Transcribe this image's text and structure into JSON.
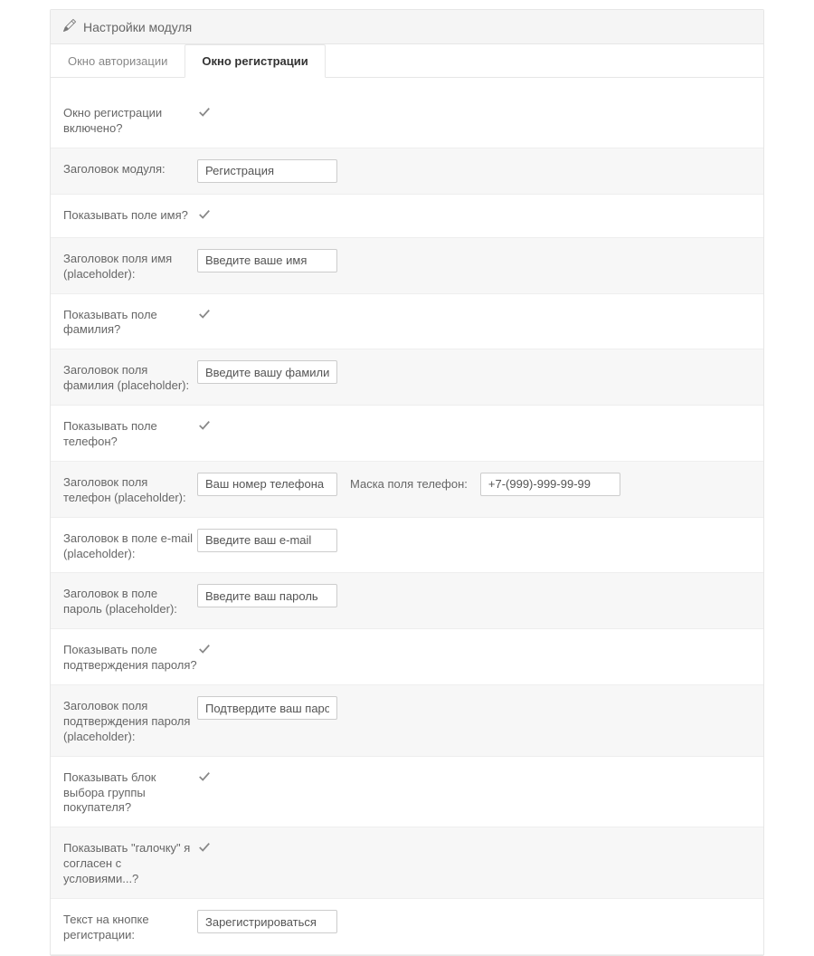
{
  "header": {
    "title": "Настройки модуля"
  },
  "tabs": {
    "auth": "Окно авторизации",
    "register": "Окно регистрации"
  },
  "rows": {
    "r0": {
      "label": "Окно регистрации включено?",
      "checked": true
    },
    "r1": {
      "label": "Заголовок модуля:",
      "value": "Регистрация"
    },
    "r2": {
      "label": "Показывать поле имя?",
      "checked": true
    },
    "r3": {
      "label": "Заголовок поля имя (placeholder):",
      "value": "Введите ваше имя"
    },
    "r4": {
      "label": "Показывать поле фамилия?",
      "checked": true
    },
    "r5": {
      "label": "Заголовок поля фамилия (placeholder):",
      "value": "Введите вашу фамилию"
    },
    "r6": {
      "label": "Показывать поле телефон?",
      "checked": true
    },
    "r7": {
      "label": "Заголовок поля телефон (placeholder):",
      "value": "Ваш номер телефона",
      "mask_label": "Маска поля телефон:",
      "mask_value": "+7-(999)-999-99-99"
    },
    "r8": {
      "label": "Заголовок в поле e-mail (placeholder):",
      "value": "Введите ваш e-mail"
    },
    "r9": {
      "label": "Заголовок в поле пароль (placeholder):",
      "value": "Введите ваш пароль"
    },
    "r10": {
      "label": "Показывать поле подтверждения пароля?",
      "checked": true
    },
    "r11": {
      "label": "Заголовок поля подтверждения пароля (placeholder):",
      "value": "Подтвердите ваш пароль"
    },
    "r12": {
      "label": "Показывать блок выбора группы покупателя?",
      "checked": true
    },
    "r13": {
      "label": "Показывать \"галочку\" я согласен с условиями...?",
      "checked": true
    },
    "r14": {
      "label": "Текст на кнопке регистрации:",
      "value": "Зарегистрироваться"
    }
  }
}
